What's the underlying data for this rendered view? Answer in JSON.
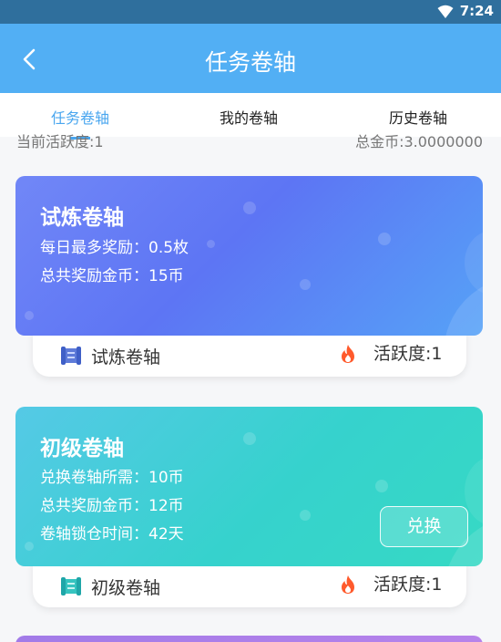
{
  "status_bar": {
    "time": "7:24"
  },
  "header": {
    "title": "任务卷轴"
  },
  "tabs": [
    {
      "label": "任务卷轴"
    },
    {
      "label": "我的卷轴"
    },
    {
      "label": "历史卷轴"
    }
  ],
  "summary": {
    "activity": "当前活跃度:1",
    "total_coins": "总金币:3.0000000"
  },
  "cards": [
    {
      "title": "试炼卷轴",
      "lines": [
        "每日最多奖励：0.5枚",
        "总共奖励金币：15币"
      ],
      "footer_name": "试炼卷轴",
      "footer_activity": "活跃度:1"
    },
    {
      "title": "初级卷轴",
      "lines": [
        "兑换卷轴所需：10币",
        "总共奖励金币：12币",
        "卷轴锁仓时间：42天"
      ],
      "button_label": "兑换",
      "footer_name": "初级卷轴",
      "footer_activity": "活跃度:1"
    }
  ],
  "colors": {
    "header": "#52aff4",
    "accent": "#49a6ef",
    "trial_card": "#6a7ef6",
    "basic_card": "#3ed1d1",
    "fire": "#ff5a2c"
  },
  "icons": [
    "back-icon",
    "wifi-icon",
    "scroll-icon",
    "fire-icon"
  ]
}
